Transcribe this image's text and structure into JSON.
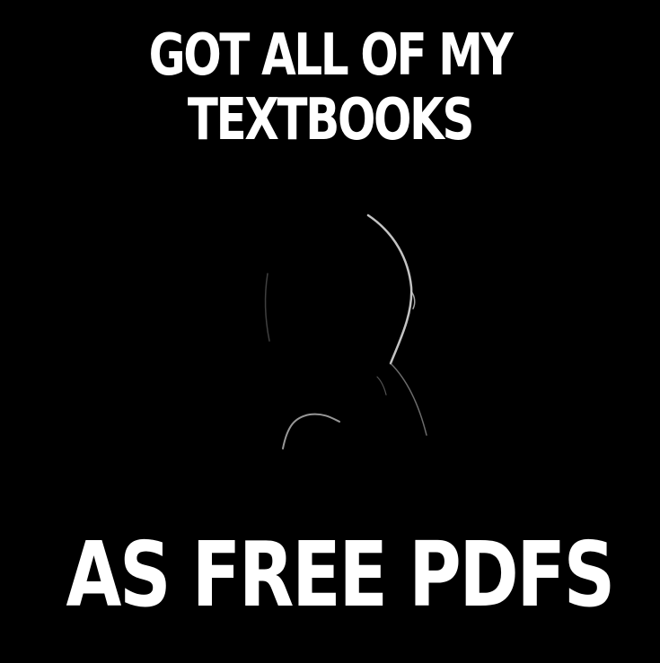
{
  "meme": {
    "top_text": {
      "line1": "GOT ALL OF MY",
      "line2": "TEXTBOOKS"
    },
    "bottom_text": "AS FREE PDFS",
    "background_color": "#000000",
    "text_color": "#ffffff",
    "figure": "shadowy-silhouette-icon"
  }
}
